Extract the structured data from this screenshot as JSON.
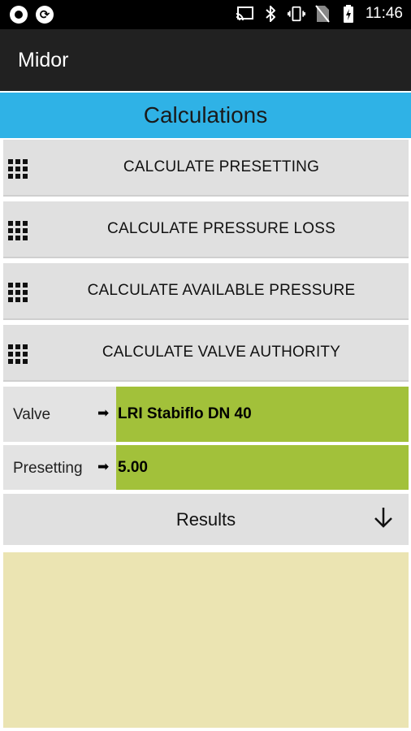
{
  "status_bar": {
    "time": "11:46",
    "icons": [
      "record-icon",
      "sync-icon",
      "cast-icon",
      "bluetooth-icon",
      "vibrate-icon",
      "no-sim-icon",
      "battery-charging-icon"
    ]
  },
  "app_bar": {
    "title": "Midor"
  },
  "section": {
    "title": "Calculations"
  },
  "actions": [
    {
      "label": "CALCULATE PRESETTING",
      "icon": "grid-icon"
    },
    {
      "label": "CALCULATE PRESSURE LOSS",
      "icon": "grid-icon"
    },
    {
      "label": "CALCULATE AVAILABLE PRESSURE",
      "icon": "grid-icon"
    },
    {
      "label": "CALCULATE VALVE AUTHORITY",
      "icon": "grid-icon"
    }
  ],
  "fields": {
    "valve": {
      "label": "Valve",
      "value": "LRI Stabiflo  DN 40"
    },
    "presetting": {
      "label": "Presetting",
      "value": "5.00"
    }
  },
  "results": {
    "label": "Results",
    "icon": "arrow-down-icon"
  },
  "colors": {
    "header_blue": "#2fb2e6",
    "value_green": "#a2c13a",
    "results_panel": "#ebe4b2"
  }
}
